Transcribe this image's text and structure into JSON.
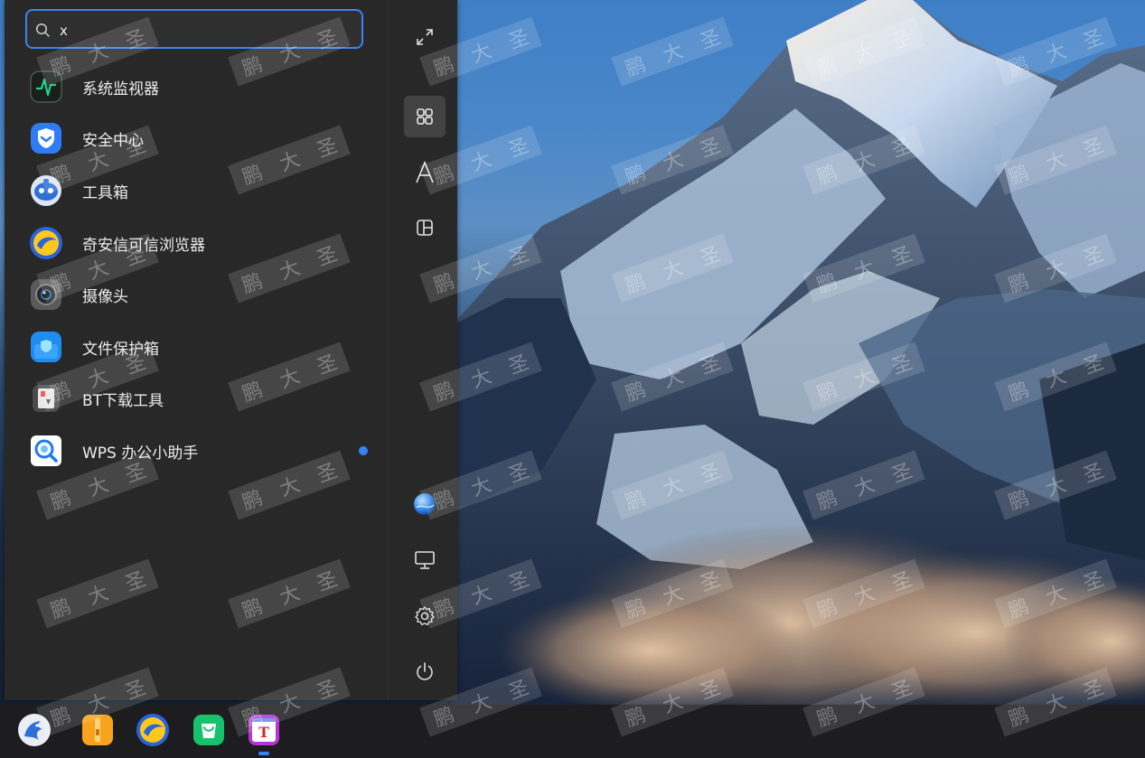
{
  "search": {
    "value": "x",
    "placeholder": ""
  },
  "apps": [
    {
      "label": "系统监视器",
      "icon": "system-monitor-icon"
    },
    {
      "label": "安全中心",
      "icon": "security-center-icon"
    },
    {
      "label": "工具箱",
      "icon": "toolbox-icon"
    },
    {
      "label": "奇安信可信浏览器",
      "icon": "qianxin-browser-icon"
    },
    {
      "label": "摄像头",
      "icon": "camera-icon"
    },
    {
      "label": "文件保护箱",
      "icon": "file-protection-icon"
    },
    {
      "label": "BT下载工具",
      "icon": "bt-download-icon"
    },
    {
      "label": "WPS 办公小助手",
      "icon": "wps-assistant-icon",
      "badge": true
    }
  ],
  "sidebar": {
    "buttons": [
      "fullscreen-icon",
      "category-grid-icon",
      "letter-sort-icon",
      "function-sort-icon",
      "user-avatar-icon",
      "computer-icon",
      "settings-icon",
      "power-icon"
    ],
    "active": "category-grid-icon"
  },
  "taskbar": {
    "items": [
      "start-menu-icon",
      "file-manager-icon",
      "browser-icon",
      "app-store-icon",
      "text-editor-icon"
    ],
    "active": "text-editor-icon"
  },
  "watermark": {
    "chars": [
      "鹏",
      "大",
      "圣"
    ]
  },
  "colors": {
    "accent": "#3b82f6",
    "menu_bg": "#282828",
    "taskbar_bg": "#1d1d1f"
  }
}
